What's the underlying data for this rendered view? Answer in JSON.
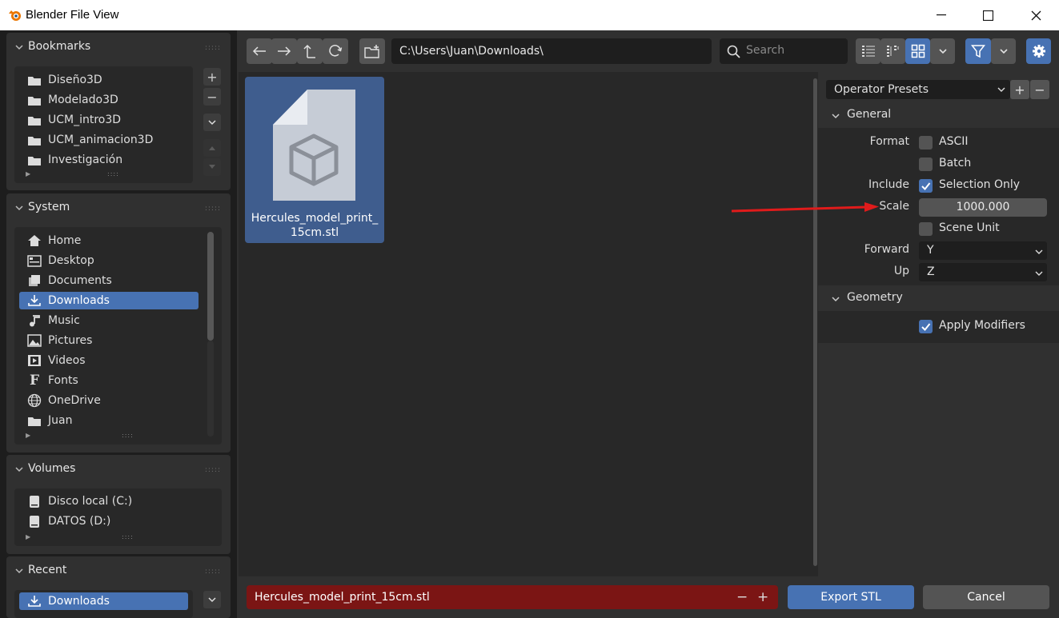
{
  "window": {
    "title": "Blender File View"
  },
  "bookmarks": {
    "title": "Bookmarks",
    "items": [
      "Diseño3D",
      "Modelado3D",
      "UCM_intro3D",
      "UCM_animacion3D",
      "Investigación"
    ]
  },
  "system": {
    "title": "System",
    "items": [
      "Home",
      "Desktop",
      "Documents",
      "Downloads",
      "Music",
      "Pictures",
      "Videos",
      "Fonts",
      "OneDrive",
      "Juan"
    ],
    "active": "Downloads"
  },
  "volumes": {
    "title": "Volumes",
    "items": [
      "Disco local (C:)",
      "DATOS (D:)"
    ]
  },
  "recent": {
    "title": "Recent",
    "items": [
      "Downloads"
    ]
  },
  "toolbar": {
    "path": "C:\\Users\\Juan\\Downloads\\",
    "search_placeholder": "Search"
  },
  "files": [
    {
      "name": "Hercules_model_print_15cm.stl",
      "label_line1": "Hercules_model_print_",
      "label_line2": "15cm.stl"
    }
  ],
  "properties": {
    "presets_label": "Operator Presets",
    "general": {
      "title": "General",
      "format_label": "Format",
      "ascii_label": "ASCII",
      "ascii_checked": false,
      "batch_label": "Batch",
      "batch_checked": false,
      "include_label": "Include",
      "selection_only_label": "Selection Only",
      "selection_only_checked": true,
      "scale_label": "Scale",
      "scale_value": "1000.000",
      "scene_unit_label": "Scene Unit",
      "scene_unit_checked": false,
      "forward_label": "Forward",
      "forward_value": "Y",
      "up_label": "Up",
      "up_value": "Z"
    },
    "geometry": {
      "title": "Geometry",
      "apply_modifiers_label": "Apply Modifiers",
      "apply_modifiers_checked": true
    }
  },
  "footer": {
    "filename": "Hercules_model_print_15cm.stl",
    "export_label": "Export STL",
    "cancel_label": "Cancel"
  },
  "colors": {
    "accent": "#4772b3",
    "filename_bg": "#7b1514",
    "annotation_arrow": "#e01b1b"
  }
}
